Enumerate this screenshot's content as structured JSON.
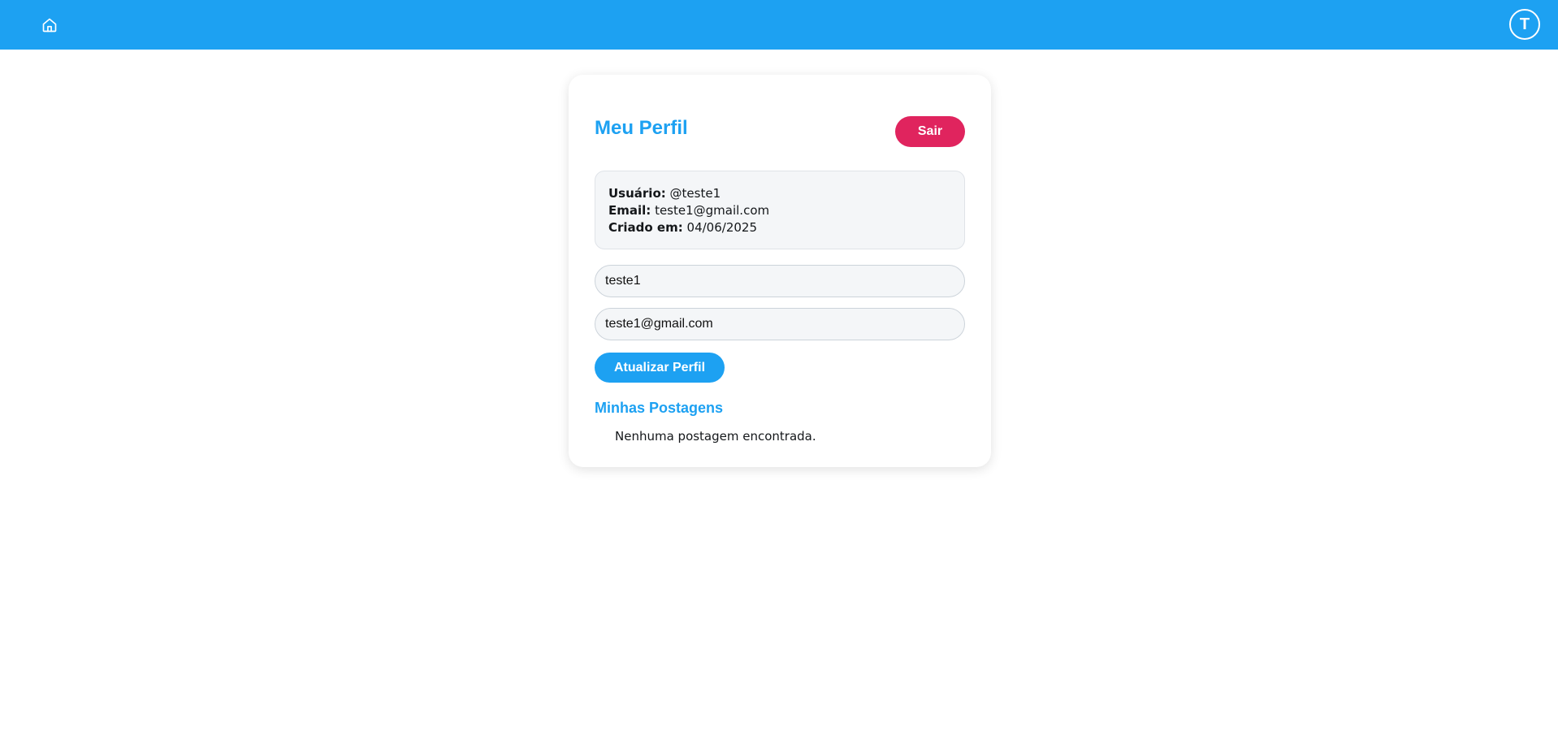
{
  "header": {
    "home_icon": "home-icon",
    "avatar_initial": "T"
  },
  "profile": {
    "title": "Meu Perfil",
    "logout_label": "Sair",
    "info": {
      "user_label": "Usuário:",
      "user_value": "@teste1",
      "email_label": "Email:",
      "email_value": "teste1@gmail.com",
      "created_label": "Criado em:",
      "created_value": "04/06/2025"
    },
    "form": {
      "username_value": "teste1",
      "email_value": "teste1@gmail.com",
      "update_label": "Atualizar Perfil"
    },
    "posts": {
      "title": "Minhas Postagens",
      "empty_message": "Nenhuma postagem encontrada."
    }
  },
  "colors": {
    "primary": "#1da1f2",
    "danger": "#e0245e",
    "info_bg": "#f4f6f8"
  }
}
